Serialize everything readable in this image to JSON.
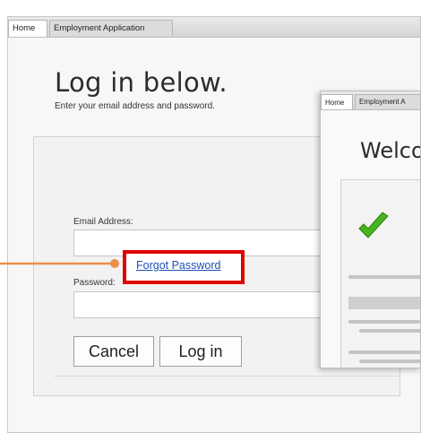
{
  "back_window": {
    "tabs": [
      {
        "label": "Home"
      },
      {
        "label": "Employment Application"
      }
    ],
    "title": "Log in below.",
    "subtitle": "Enter your email address and password.",
    "email_label": "Email Address:",
    "password_label": "Password:",
    "forgot_link": "Forgot Password",
    "cancel_label": "Cancel",
    "login_label": "Log in"
  },
  "front_window": {
    "tabs": [
      {
        "label": "Home"
      },
      {
        "label": "Employment A"
      }
    ],
    "title": "Welco"
  },
  "colors": {
    "highlight": "#e00000",
    "arrow": "#e8904a",
    "link": "#1d4fb8",
    "check": "#46b41e"
  },
  "icons": {
    "callout_arrow": "arrow-right-icon",
    "success": "checkmark-icon"
  }
}
